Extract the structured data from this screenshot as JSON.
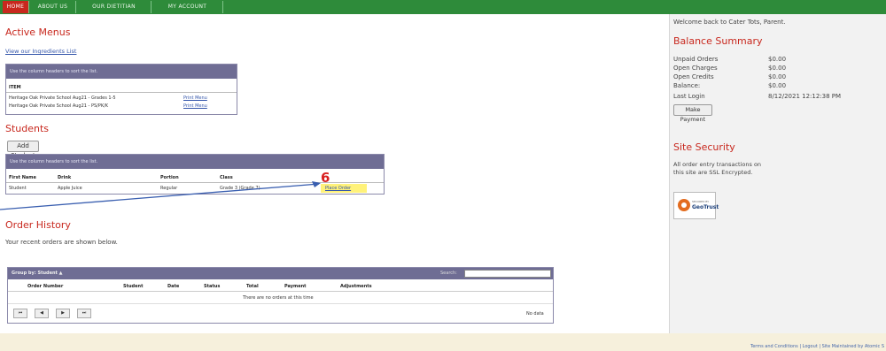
{
  "nav": {
    "tabs": [
      "HOME",
      "ABOUT US",
      "OUR DIETITIAN",
      "MY ACCOUNT"
    ]
  },
  "active_menus": {
    "title": "Active Menus",
    "ingredients_link": "View our Ingredients List",
    "table_hint": "Use the column headers to sort the list.",
    "column_item": "ITEM",
    "rows": [
      {
        "item": "Heritage Oak Private School Aug21 - Grades 1-5",
        "action": "Print Menu"
      },
      {
        "item": "Heritage Oak Private School Aug21 - PS/PK/K",
        "action": "Print Menu"
      }
    ]
  },
  "students": {
    "title": "Students",
    "add_button": "Add Student",
    "table_hint": "Use the column headers to sort the list.",
    "columns": [
      "First Name",
      "Drink",
      "Portion",
      "Class"
    ],
    "rows": [
      {
        "first_name": "Student",
        "drink": "Apple Juice",
        "portion": "Regular",
        "class": "Grade 3 (Grade 7)",
        "action": "Place Order"
      }
    ],
    "annotation": "6"
  },
  "order_history": {
    "title": "Order History",
    "subtitle": "Your recent orders are shown below.",
    "group_by": "Group by: Student ▲",
    "search_label": "Search:",
    "search_value": "",
    "columns": [
      "Order Number",
      "Student",
      "Date",
      "Status",
      "Total",
      "Payment",
      "Adjustments"
    ],
    "empty_message": "There are no orders at this time",
    "pager": [
      "⏮",
      "◀",
      "▶",
      "⏭"
    ],
    "no_data": "No data"
  },
  "right": {
    "welcome": "Welcome back to Cater Tots, Parent.",
    "balance_title": "Balance Summary",
    "balance_rows": [
      {
        "label": "Unpaid Orders",
        "value": "$0.00"
      },
      {
        "label": "Open Charges",
        "value": "$0.00"
      },
      {
        "label": "Open Credits",
        "value": "$0.00"
      },
      {
        "label": "Balance:",
        "value": "$0.00"
      },
      {
        "label": "Last Login",
        "value": "8/12/2021 12:12:38 PM"
      }
    ],
    "make_payment": "Make Payment",
    "security_title": "Site Security",
    "security_text_1": "All order entry transactions on",
    "security_text_2": "this site are SSL Encrypted.",
    "badge_small": "SECURED BY",
    "badge_name": "GeoTrust"
  },
  "footer": {
    "links": "Terms and Conditions | Logout | Site Maintained by Atomic S"
  },
  "colors": {
    "nav_green": "#2e8b3a",
    "active_tab_red": "#c8281e",
    "heading_red": "#c8281e",
    "grid_header_purple": "#6f6d94",
    "highlight_yellow": "#fff27a",
    "arrow_blue": "#3a5fb0"
  }
}
